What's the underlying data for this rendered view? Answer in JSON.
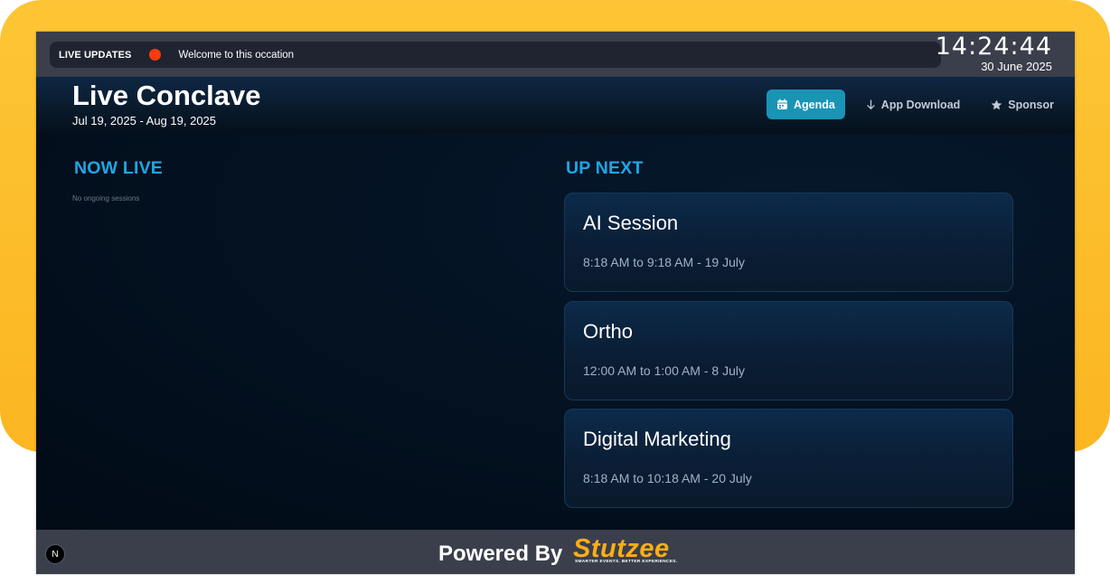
{
  "colors": {
    "accent": "#1ea7e6",
    "active_button": "#1994b5",
    "live_dot": "#ff3a0e",
    "brand": "#fbae17",
    "frame": "#fbb621"
  },
  "ticker": {
    "label": "LIVE UPDATES",
    "message": "Welcome to this occation"
  },
  "clock": {
    "time": "14:24:44",
    "date": "30 June 2025"
  },
  "event": {
    "title": "Live Conclave",
    "dates": "Jul 19, 2025 - Aug 19, 2025"
  },
  "nav": {
    "agenda": {
      "label": "Agenda",
      "icon": "calendar-icon"
    },
    "app_download": {
      "label": "App Download",
      "icon": "arrow-down-icon"
    },
    "sponsor": {
      "label": "Sponsor",
      "icon": "star-icon"
    }
  },
  "now_live": {
    "title": "NOW LIVE",
    "empty": "No ongoing sessions"
  },
  "up_next": {
    "title": "UP NEXT",
    "sessions": [
      {
        "title": "AI Session",
        "time": "8:18 AM to 9:18 AM - 19 July"
      },
      {
        "title": "Ortho",
        "time": "12:00 AM to 1:00 AM - 8 July"
      },
      {
        "title": "Digital Marketing",
        "time": "8:18 AM to 10:18 AM - 20 July"
      }
    ]
  },
  "footer": {
    "badge": "N",
    "powered_by": "Powered By",
    "brand_name": "Stutzee",
    "brand_tagline": "SMARTER EVENTS. BETTER EXPERIENCES."
  }
}
